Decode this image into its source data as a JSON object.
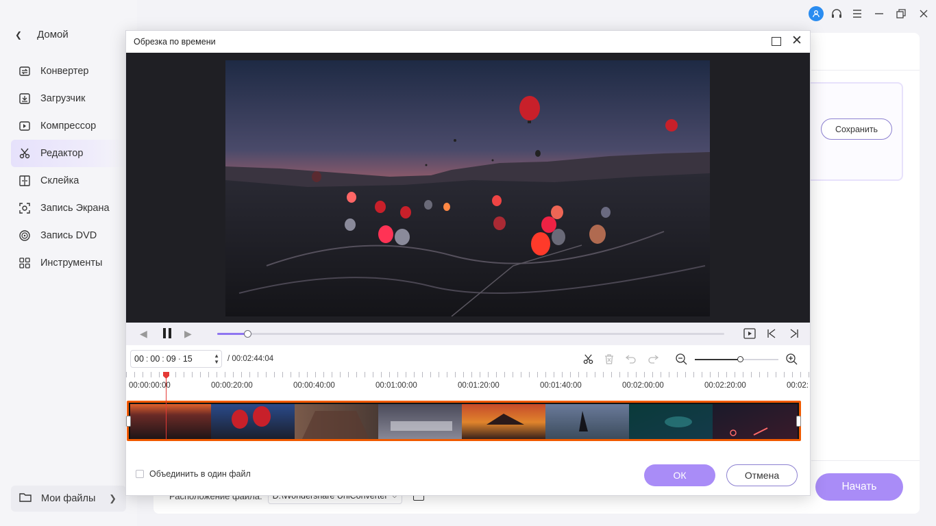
{
  "sidebar": {
    "home_label": "Домой",
    "items": [
      {
        "label": "Конвертер",
        "icon": "converter-icon"
      },
      {
        "label": "Загрузчик",
        "icon": "download-icon"
      },
      {
        "label": "Компрессор",
        "icon": "compress-icon"
      },
      {
        "label": "Редактор",
        "icon": "scissors-icon",
        "active": true
      },
      {
        "label": "Склейка",
        "icon": "merge-icon"
      },
      {
        "label": "Запись Экрана",
        "icon": "screen-record-icon"
      },
      {
        "label": "Запись DVD",
        "icon": "dvd-icon"
      },
      {
        "label": "Инструменты",
        "icon": "tools-icon"
      }
    ],
    "my_files": "Мои файлы"
  },
  "main": {
    "save_label": "Сохранить",
    "start_label": "Начать",
    "location_label": "Расположение файла:",
    "location_value": "D:\\Wondershare UniConverter"
  },
  "dialog": {
    "title": "Обрезка по времени",
    "time": {
      "hh": "00",
      "mm": "00",
      "ss": "09",
      "ff": "15",
      "total": "/ 00:02:44:04"
    },
    "progress_fraction": 0.06,
    "zoom_fraction": 0.54,
    "ruler_labels": [
      "00:00:00:00",
      "00:00:20:00",
      "00:00:40:00",
      "00:01:00:00",
      "00:01:20:00",
      "00:01:40:00",
      "00:02:00:00",
      "00:02:20:00",
      "00:02:"
    ],
    "merge_label": "Объединить в один файл",
    "ok_label": "ОК",
    "cancel_label": "Отмена"
  },
  "colors": {
    "accent": "#a98cf7",
    "timeline_border": "#f05a00",
    "playhead": "#e53935"
  }
}
